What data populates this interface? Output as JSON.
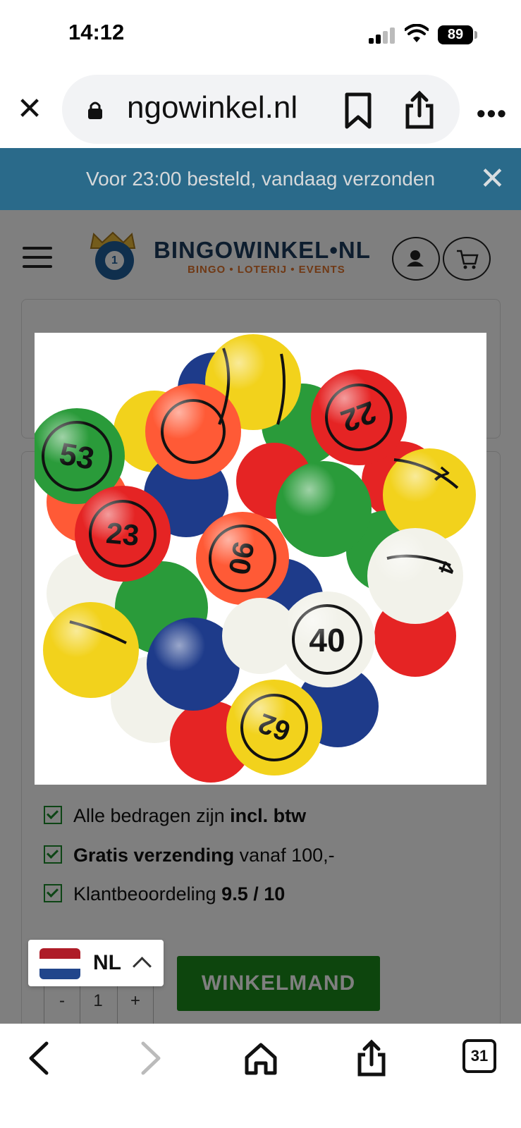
{
  "status_bar": {
    "time": "14:12",
    "battery": "89"
  },
  "browser": {
    "url": "ngowinkel.nl",
    "close_icon": "close-icon",
    "lock_icon": "lock-icon",
    "bookmark_icon": "bookmark-icon",
    "share_icon": "share-icon",
    "more_icon": "more-icon",
    "more_label": "•••"
  },
  "banner": {
    "text": "Voor 23:00 besteld, vandaag verzonden",
    "close_label": "✕"
  },
  "header": {
    "logo_title": "BINGOWINKEL•NL",
    "logo_subtitle": "BINGO • LOTERIJ • EVENTS",
    "logo_ball_number": "1"
  },
  "benefits": [
    {
      "prefix": "Alle bedragen zijn ",
      "bold": "incl. btw",
      "suffix": ""
    },
    {
      "prefix": "",
      "bold": "Gratis verzending",
      "suffix": " vanaf 100,-"
    },
    {
      "prefix": "Klantbeoordeling ",
      "bold": "9.5 / 10",
      "suffix": ""
    }
  ],
  "quantity": {
    "minus": "-",
    "value": "1",
    "plus": "+"
  },
  "cart_button": {
    "label": "WINKELMAND"
  },
  "language": {
    "code": "NL"
  },
  "image_modal": {
    "description_numbers": [
      "53",
      "22",
      "23",
      "90",
      "40",
      "62",
      "7",
      "4"
    ]
  },
  "toolbar": {
    "tabs_count": "31"
  },
  "colors": {
    "banner_bg": "#2a6a8a",
    "cart_button": "#1b8a1b",
    "logo_blue": "#1a3b5c",
    "logo_orange": "#e0722a"
  }
}
